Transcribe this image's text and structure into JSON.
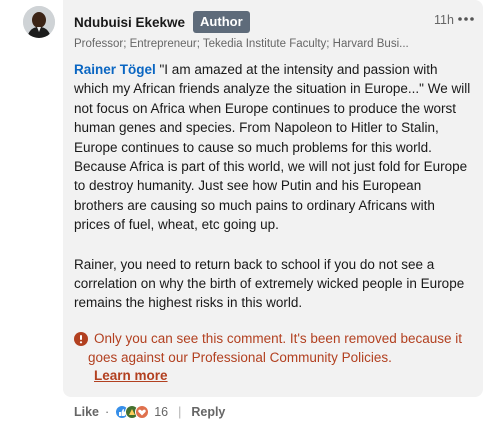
{
  "comment": {
    "author_name": "Ndubuisi Ekekwe",
    "author_badge": "Author",
    "timestamp": "11h",
    "more_icon": "ellipsis-icon",
    "headline": "Professor; Entrepreneur; Tekedia Institute Faculty; Harvard Busi...",
    "mention": "Rainer Tögel",
    "body_para1": " \"I am amazed at the intensity and passion with which my African friends analyze the situation in Europe...\" We will not focus on Africa when Europe continues to produce the worst human genes and species. From Napoleon to Hitler to Stalin, Europe continues to cause so much problems for this world. Because Africa is part of this world, we will not just fold for Europe to destroy humanity. Just see how Putin and his European brothers are causing so much pains to ordinary Africans with prices of fuel, wheat, etc going up.",
    "body_para2": "Rainer, you need to return back to school if you do not see a correlation on why the birth of extremely wicked people in Europe remains the highest risks in this world.",
    "notice_icon": "warning-icon",
    "notice_text": "Only you can see this comment. It's been removed because it goes against our Professional Community Policies.",
    "learn_more": "Learn more"
  },
  "actions": {
    "like_label": "Like",
    "dot": "·",
    "reaction_count": "16",
    "separator": "|",
    "reply_label": "Reply",
    "reaction_icons": [
      "like-icon",
      "celebrate-icon",
      "love-icon"
    ]
  },
  "colors": {
    "mention": "#0a66c2",
    "notice": "#b24020",
    "badge_bg": "#5e6b7a",
    "bubble_bg": "#f2f2f2"
  }
}
